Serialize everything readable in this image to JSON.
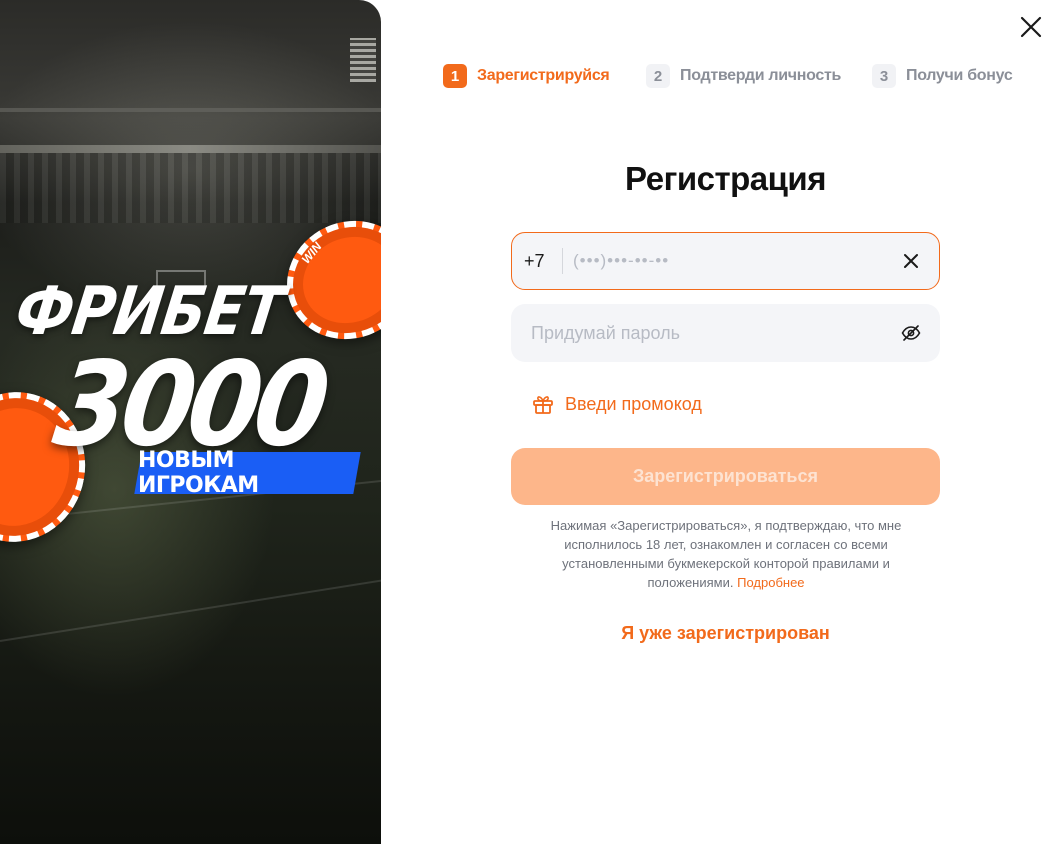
{
  "promo": {
    "title_line1": "ФРИБЕТ",
    "title_line2": "3000",
    "ribbon": "НОВЫМ ИГРОКАМ",
    "chip_label": "WIN"
  },
  "steps": [
    {
      "number": "1",
      "label": "Зарегистрируйся",
      "state": "active"
    },
    {
      "number": "2",
      "label": "Подтверди личность",
      "state": "inactive"
    },
    {
      "number": "3",
      "label": "Получи бонус",
      "state": "inactive"
    }
  ],
  "form": {
    "title": "Регистрация",
    "phone_prefix": "+7",
    "phone_placeholder": "(•••)•••-••-••",
    "password_placeholder": "Придумай пароль",
    "promo_link": "Введи промокод",
    "submit_label": "Зарегистрироваться",
    "terms_text": "Нажимая «Зарегистрироваться», я подтверждаю, что мне исполнилось 18 лет, ознакомлен и согласен со всеми установленными букмекерской конторой правилами и положениями.",
    "terms_link": "Подробнее",
    "login_link": "Я уже зарегистрирован"
  },
  "colors": {
    "accent": "#f26a1b",
    "accent_disabled": "#fdb68a",
    "ribbon_blue": "#1a5ef5",
    "field_bg": "#f4f5f8"
  },
  "icons": {
    "close": "close-icon",
    "clear": "clear-icon",
    "eye": "eye-off-icon",
    "gift": "gift-icon"
  }
}
